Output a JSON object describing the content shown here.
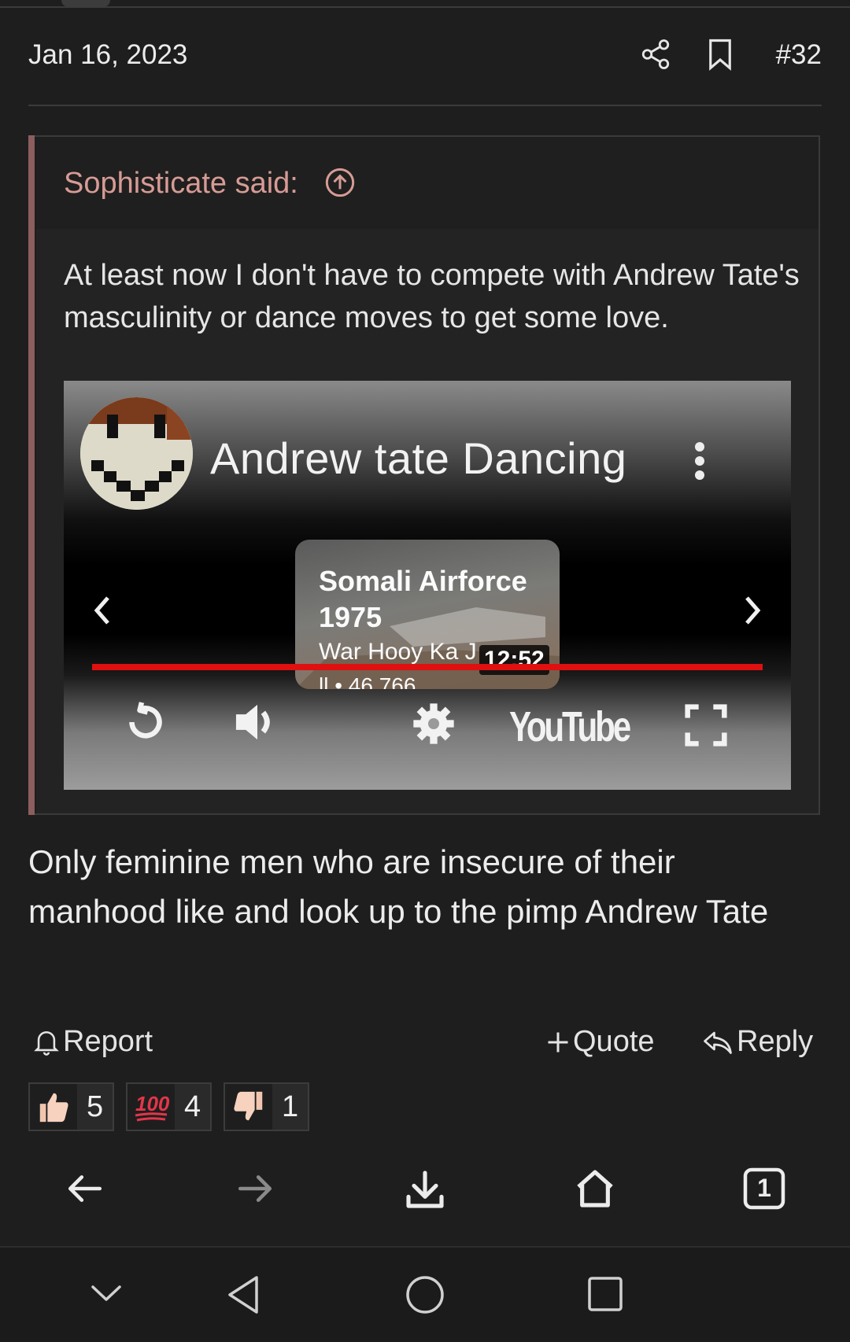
{
  "post": {
    "date": "Jan 16, 2023",
    "number": "#32",
    "icons": {
      "share": "share-icon",
      "bookmark": "bookmark-icon"
    }
  },
  "quote": {
    "author": "Sophisticate said:",
    "icon": "arrow-up-circle-icon",
    "text": "At least now I don't have to compete with Andrew Tate's masculinity or dance moves to get some love.",
    "accent_color": "#8c5e5e",
    "author_color": "#d79b95"
  },
  "video": {
    "title": "Andrew tate Dancing",
    "card": {
      "title": "Somali Airforce 1975",
      "subtitle": "War Hooy Ka J",
      "views": "ll • 46,766",
      "duration": "12:52"
    },
    "progress_color": "#e01010",
    "brand": "YouTube",
    "controls": [
      "replay-icon",
      "volume-icon",
      "settings-icon",
      "fullscreen-icon"
    ]
  },
  "message": {
    "text": "Only feminine men who are insecure of their manhood like and look up to the pimp Andrew Tate"
  },
  "actions": {
    "report": "Report",
    "quote": "Quote",
    "reply": "Reply"
  },
  "reactions": [
    {
      "icon": "thumbs-up-icon",
      "count": "5"
    },
    {
      "icon": "hundred-points-icon",
      "count": "4"
    },
    {
      "icon": "thumbs-down-icon",
      "count": "1"
    }
  ],
  "browser_toolbar": {
    "tabs_count": "1",
    "icons": [
      "back-arrow-icon",
      "forward-arrow-icon",
      "download-icon",
      "home-icon",
      "tabs-icon"
    ]
  },
  "system_nav": {
    "icons": [
      "collapse-icon",
      "back-triangle-icon",
      "home-circle-icon",
      "recents-square-icon"
    ]
  }
}
